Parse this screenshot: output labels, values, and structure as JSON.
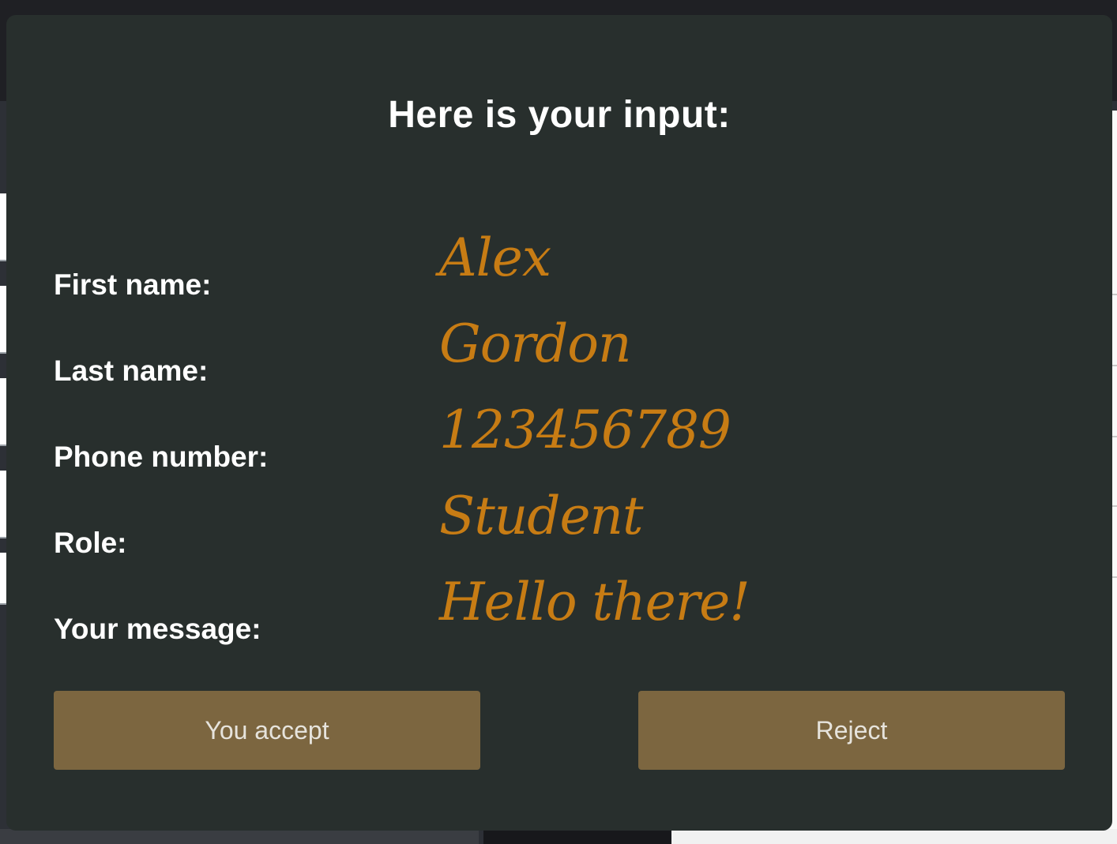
{
  "modal": {
    "title": "Here is your input:",
    "fields": [
      {
        "label": "First name:",
        "value": "Alex"
      },
      {
        "label": "Last name:",
        "value": "Gordon"
      },
      {
        "label": "Phone number:",
        "value": "123456789"
      },
      {
        "label": "Role:",
        "value": "Student"
      },
      {
        "label": "Your message:",
        "value": "Hello there!"
      }
    ],
    "buttons": {
      "accept_label": "You accept",
      "reject_label": "Reject"
    }
  },
  "colors": {
    "modal_background": "#282f2d",
    "value_text": "#c77c14",
    "button_background": "#7c6640",
    "label_text": "#ffffff"
  }
}
